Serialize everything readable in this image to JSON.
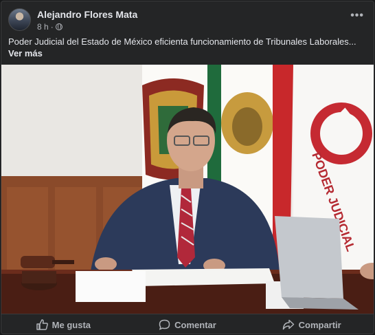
{
  "post": {
    "author": "Alejandro Flores Mata",
    "time": "8 h",
    "separator": "·",
    "privacy_icon": "globe-icon",
    "menu_icon": "more-options-icon",
    "caption": "Poder Judicial del Estado de México eficienta funcionamiento de Tribunales Laborales...",
    "see_more": "Ver más"
  },
  "photo": {
    "subject": "press-photo"
  },
  "actions": {
    "like": "Me gusta",
    "comment": "Comentar",
    "share": "Compartir"
  },
  "colors": {
    "background": "#242526",
    "text_primary": "#e4e6eb",
    "text_secondary": "#b0b3b8",
    "border": "#3a3b3c"
  }
}
